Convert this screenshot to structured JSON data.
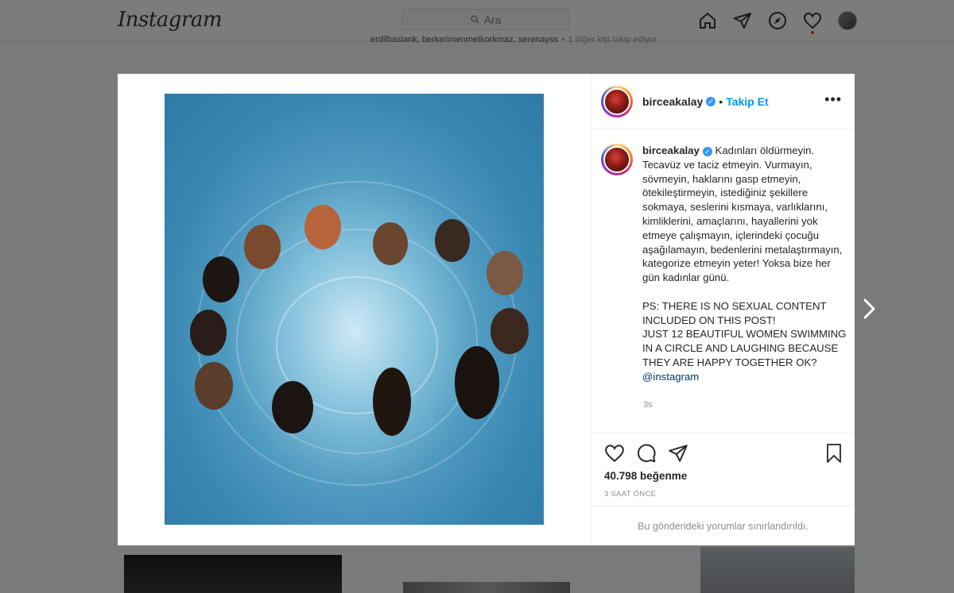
{
  "header": {
    "logo": "Instagram",
    "search_placeholder": "Ara"
  },
  "background": {
    "followed_by_names": "erdilbaslank, berkerimenmetkorkmaz, serenayss",
    "followed_by_more": "+ 1 diğer kişi takip ediyor"
  },
  "post": {
    "username": "birceakalay",
    "follow_label": "Takip Et",
    "caption_username": "birceakalay",
    "caption": "Kadınları öldürmeyin. Tecavüz ve taciz etmeyin. Vurmayın, sövmeyin, haklarını gasp etmeyin, ötekileştirmeyin, istediğiniz şekillere sokmaya, seslerini kısmaya, varlıklarını, kimliklerini, amaçlarını, hayallerini yok etmeye çalışmayın, içlerindeki çocuğu aşağılamayın, bedenlerini metalaştırmayın, kategorize etmeyin yeter! Yoksa bize her gün kadınlar günü.\n\nPS: THERE IS NO SEXUAL CONTENT INCLUDED ON THIS POST!\nJUST 12 BEAUTIFUL WOMEN SWIMMING IN A CIRCLE AND LAUGHING BECAUSE THEY ARE HAPPY TOGETHER OK? ",
    "caption_mention": "@instagram",
    "caption_time": "3s",
    "likes": "40.798 beğenme",
    "time_ago": "3 SAAT ÖNCE",
    "comments_limited": "Bu gönderideki yorumlar sınırlandırıldı."
  },
  "icons": {
    "home": "home-icon",
    "direct": "paper-plane-icon",
    "explore": "compass-icon",
    "activity": "heart-icon",
    "like": "heart-icon",
    "comment": "comment-icon",
    "share": "paper-plane-icon",
    "save": "bookmark-icon",
    "next": "chevron-right-icon"
  },
  "colors": {
    "accent": "#0095f6",
    "verified": "#3897f0",
    "overlay": "#7a7a7a"
  }
}
